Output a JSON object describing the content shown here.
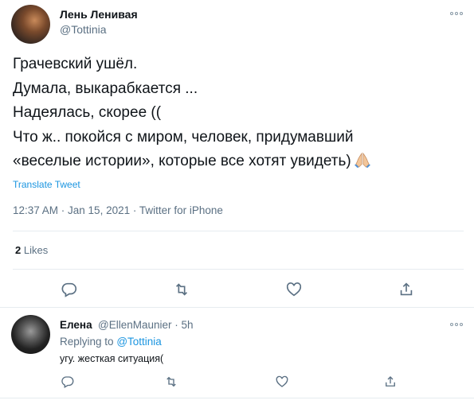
{
  "tweet": {
    "author_name": "Лень Ленивая",
    "author_handle": "@Tottinia",
    "lines": [
      "Грачевский ушёл.",
      "Думала, выкарабкается ...",
      "Надеялась, скорее ((",
      "Что ж.. покойся с миром, человек, придумавший",
      "«веселые истории», которые все хотят увидеть)"
    ],
    "emoji": "folded-hands-icon",
    "translate_label": "Translate Tweet",
    "timestamp": "12:37 AM · Jan 15, 2021 · Twitter for iPhone",
    "likes_count": "2",
    "likes_label": "Likes"
  },
  "reply": {
    "author_name": "Елена",
    "author_handle": "@EllenMaunier · 5h",
    "replying_prefix": "Replying to",
    "replying_to": "@Tottinia",
    "text": "угу. жесткая ситуация("
  },
  "colors": {
    "accent": "#1b95e0",
    "secondary_text": "#5b7083",
    "divider": "#e6ecf0"
  }
}
